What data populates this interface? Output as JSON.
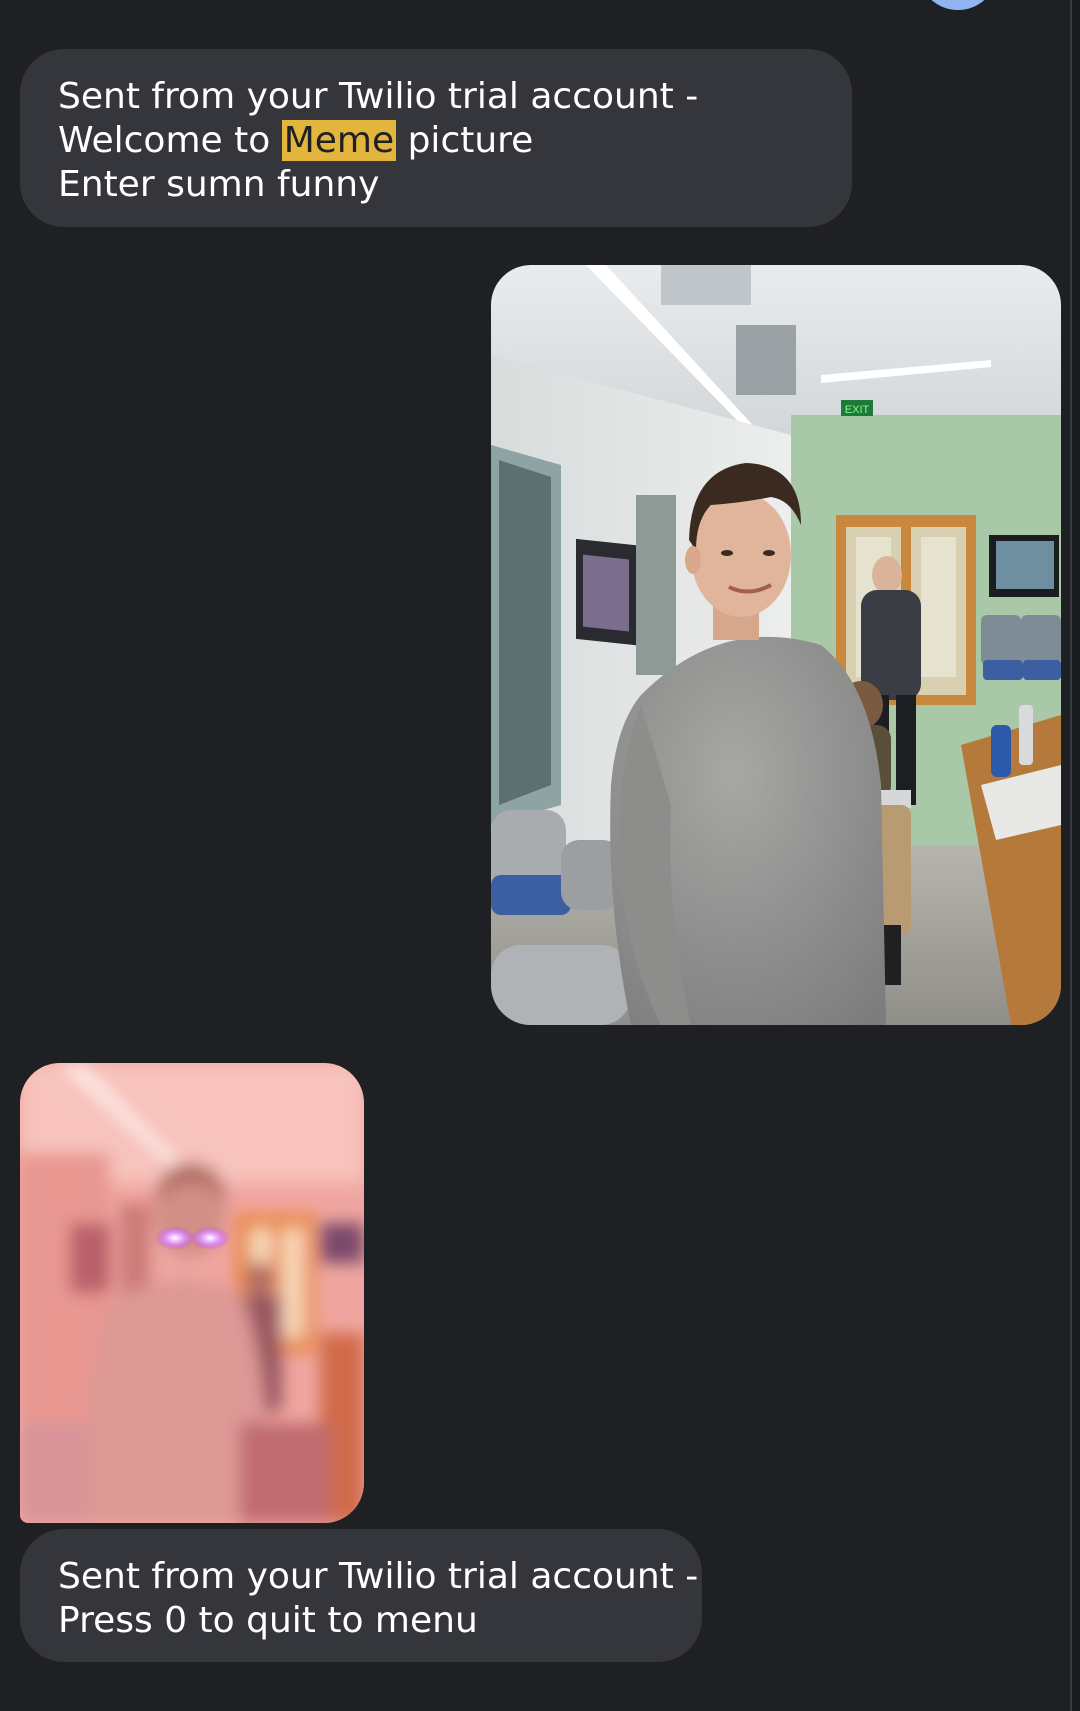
{
  "messages": [
    {
      "type": "text",
      "direction": "incoming",
      "line1": "Sent from your Twilio trial account -",
      "line2_before": "Welcome to ",
      "line2_highlight": "Meme",
      "line2_after": " picture",
      "line3": "Enter sumn funny"
    },
    {
      "type": "image",
      "direction": "outgoing",
      "exit_sign": "EXIT"
    },
    {
      "type": "image",
      "direction": "incoming"
    },
    {
      "type": "text",
      "direction": "incoming",
      "line1": "Sent from your Twilio trial account -",
      "line2": "Press 0 to quit to menu"
    }
  ],
  "colors": {
    "background": "#1f2024",
    "bubble": "#35363b",
    "highlight": "#e3b53c",
    "text": "#ffffff"
  }
}
